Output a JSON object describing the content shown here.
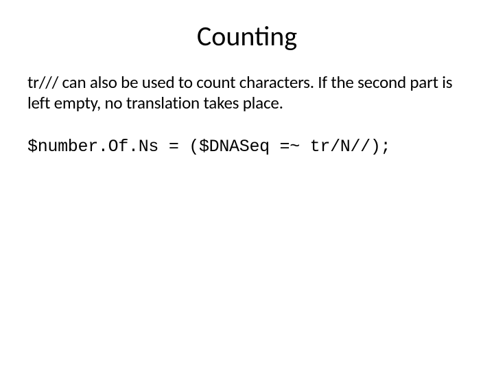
{
  "title": "Counting",
  "paragraph": "tr/// can also be used to count characters. If the second part is left empty, no translation takes place.",
  "code": "$number.Of.Ns = ($DNASeq =~ tr/N//);"
}
